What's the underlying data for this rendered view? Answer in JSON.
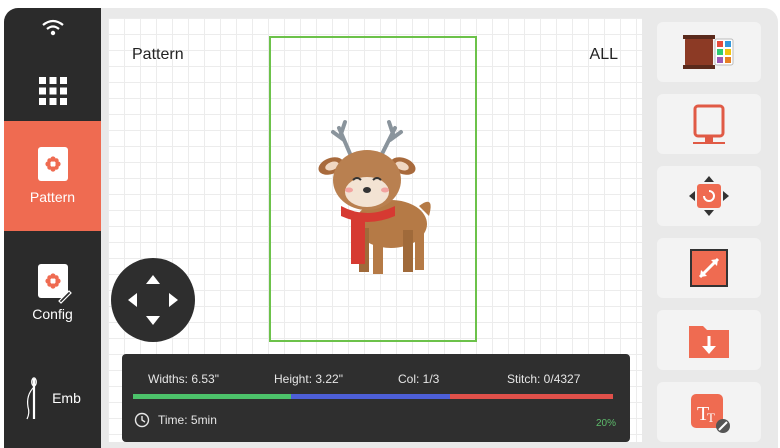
{
  "nav": {
    "pattern_label": "Pattern",
    "config_label": "Config",
    "emb_label": "Emb"
  },
  "canvas": {
    "title": "Pattern",
    "scope": "ALL"
  },
  "info": {
    "width": "Widths: 6.53\"",
    "height": "Height: 3.22\"",
    "color": "Col: 1/3",
    "stitch": "Stitch: 0/4327",
    "time": "Time: 5min",
    "percent": "20%"
  },
  "progress": {
    "segments": [
      {
        "color": "#4cc26a",
        "fraction": 0.33
      },
      {
        "color": "#4d5fd8",
        "fraction": 0.33
      },
      {
        "color": "#e0504a",
        "fraction": 0.34
      }
    ],
    "completed": 0.2
  },
  "colors": {
    "accent": "#ef6b51",
    "nav_bg": "#2b2b2b",
    "hoop": "#6cc24a"
  },
  "tools": [
    "thread-palette-icon",
    "hoop-frame-icon",
    "rotate-icon",
    "resize-icon",
    "save-to-folder-icon",
    "text-edit-icon"
  ]
}
